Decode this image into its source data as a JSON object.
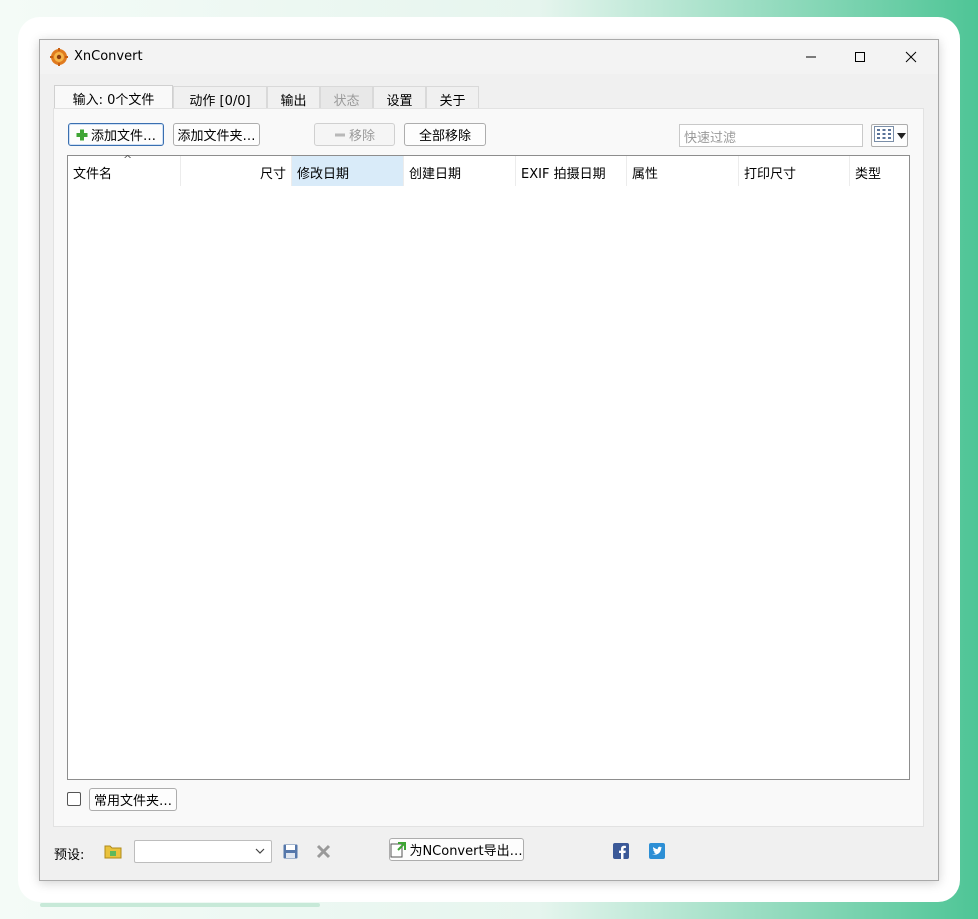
{
  "window": {
    "title": "XnConvert"
  },
  "tabs": [
    {
      "label": "输入: 0个文件",
      "active": true,
      "enabled": true
    },
    {
      "label": "动作 [0/0]",
      "active": false,
      "enabled": true
    },
    {
      "label": "输出",
      "active": false,
      "enabled": true
    },
    {
      "label": "状态",
      "active": false,
      "enabled": false
    },
    {
      "label": "设置",
      "active": false,
      "enabled": true
    },
    {
      "label": "关于",
      "active": false,
      "enabled": true
    }
  ],
  "toolbar": {
    "add_files": "添加文件…",
    "add_folder": "添加文件夹…",
    "remove": "移除",
    "remove_all": "全部移除",
    "filter_placeholder": "快速过滤"
  },
  "columns": [
    "文件名",
    "尺寸",
    "修改日期",
    "创建日期",
    "EXIF 拍摄日期",
    "属性",
    "打印尺寸",
    "类型"
  ],
  "files": [],
  "favorites": {
    "checked": false,
    "button": "常用文件夹…"
  },
  "footer": {
    "preset_label": "预设:",
    "preset_value": "",
    "export_button": "为NConvert导出…"
  },
  "colors": {
    "accent": "#3a6fb0",
    "selected_column": "#d9ebf9",
    "facebook": "#3b5998",
    "twitter": "#2d8fd5"
  }
}
